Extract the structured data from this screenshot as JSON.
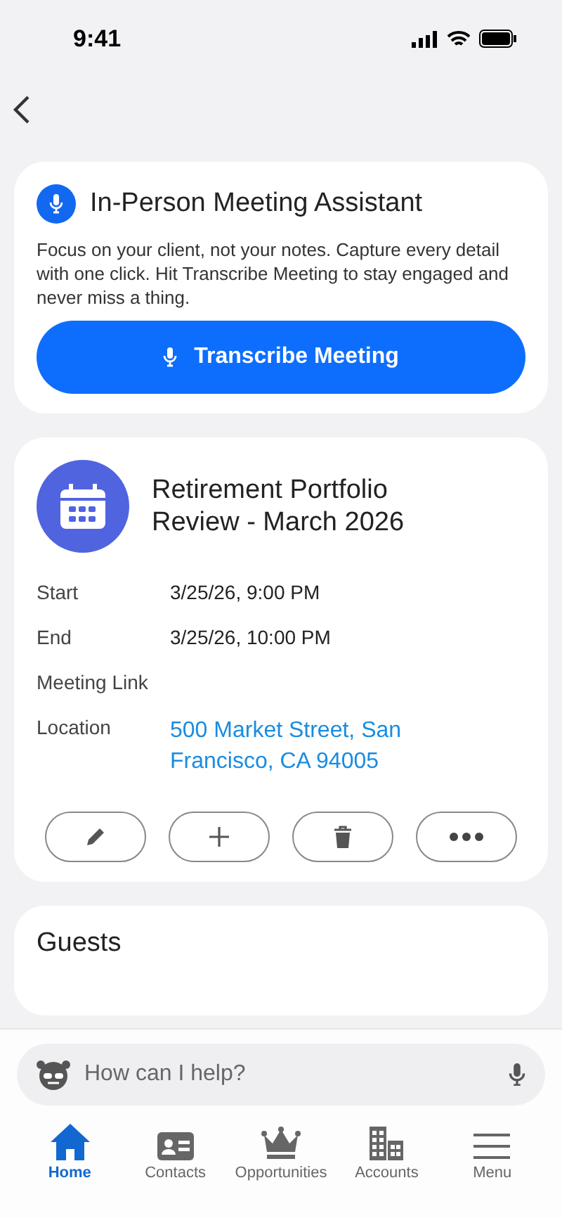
{
  "status_bar": {
    "time": "9:41"
  },
  "assistant_card": {
    "title": "In-Person Meeting Assistant",
    "description": "Focus on your client, not your notes. Capture every detail with one click. Hit Transcribe Meeting to stay engaged and never miss a thing.",
    "button": "Transcribe Meeting"
  },
  "meeting": {
    "title": "Retirement Portfolio Review - March 2026",
    "details": [
      {
        "label": "Start",
        "value": "3/25/26, 9:00 PM",
        "kind": "text"
      },
      {
        "label": "End",
        "value": "3/25/26, 10:00 PM",
        "kind": "text"
      },
      {
        "label": "Meeting Link"
      },
      {
        "label": "Location",
        "value": "500 Market Street, San Francisco, CA 94005",
        "kind": "link"
      }
    ],
    "actions": [
      {
        "kind": "edit"
      },
      {
        "kind": "add"
      },
      {
        "kind": "delete"
      },
      {
        "kind": "more"
      }
    ]
  },
  "guests": {
    "title": "Guests"
  },
  "search": {
    "placeholder": "How can I help?"
  },
  "nav": [
    {
      "label": "Home",
      "kind": "home",
      "selected": true
    },
    {
      "label": "Contacts",
      "kind": "contacts",
      "selected": false
    },
    {
      "label": "Opportunities",
      "kind": "opportunities",
      "selected": false
    },
    {
      "label": "Accounts",
      "kind": "accounts",
      "selected": false
    },
    {
      "label": "Menu",
      "kind": "menu",
      "selected": false
    }
  ]
}
